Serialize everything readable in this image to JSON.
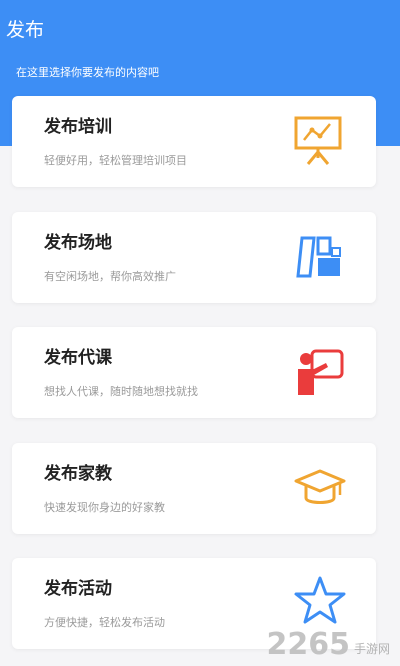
{
  "header": {
    "title": "发布",
    "subtitle": "在这里选择你要发布的内容吧"
  },
  "cards": [
    {
      "title": "发布培训",
      "desc": "轻便好用，轻松管理培训项目",
      "icon": "training-board-icon"
    },
    {
      "title": "发布场地",
      "desc": "有空闲场地，帮你高效推广",
      "icon": "venue-panels-icon"
    },
    {
      "title": "发布代课",
      "desc": "想找人代课，随时随地想找就找",
      "icon": "teacher-presenting-icon"
    },
    {
      "title": "发布家教",
      "desc": "快速发现你身边的好家教",
      "icon": "graduation-cap-icon"
    },
    {
      "title": "发布活动",
      "desc": "方便快捷，轻松发布活动",
      "icon": "star-icon"
    }
  ],
  "watermark": {
    "number": "2265",
    "suffix": "手游网"
  },
  "colors": {
    "header_blue": "#3d8ef5",
    "icon_orange": "#f0a531",
    "icon_blue": "#3d8ef5",
    "icon_red": "#ea3c3c"
  }
}
